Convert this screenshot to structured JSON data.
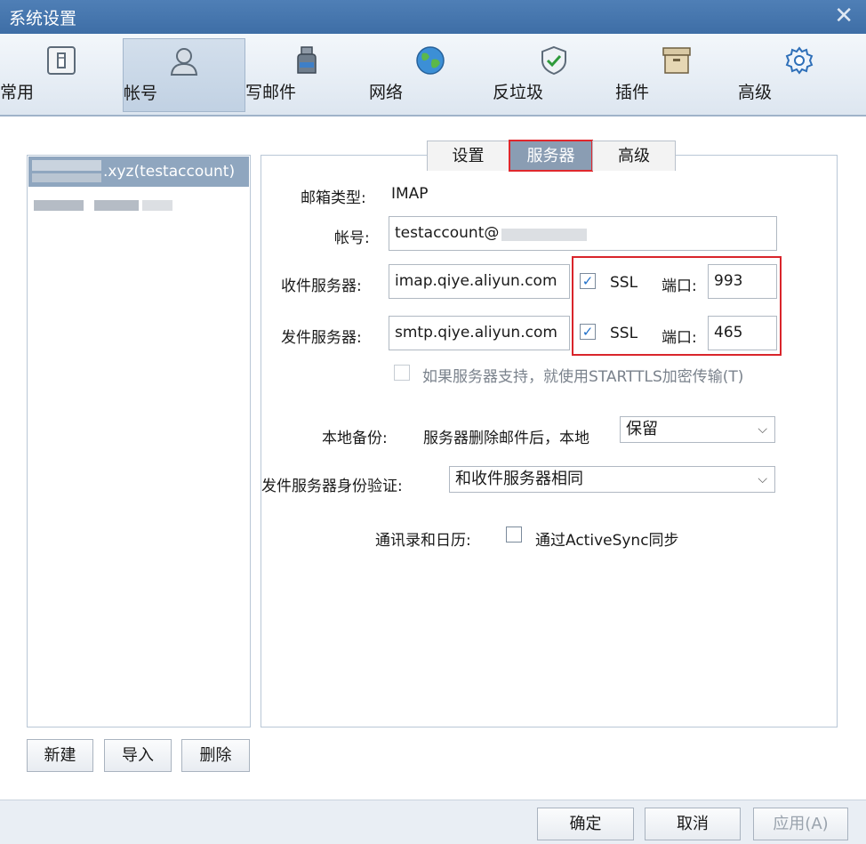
{
  "window": {
    "title": "系统设置",
    "close_glyph": "✕"
  },
  "toolbar": {
    "items": [
      {
        "label": "常用",
        "icon": "switch-icon"
      },
      {
        "label": "帐号",
        "icon": "user-icon",
        "active": true
      },
      {
        "label": "写邮件",
        "icon": "ink-bottle-icon"
      },
      {
        "label": "网络",
        "icon": "globe-icon"
      },
      {
        "label": "反垃圾",
        "icon": "shield-check-icon"
      },
      {
        "label": "插件",
        "icon": "box-icon"
      },
      {
        "label": "高级",
        "icon": "gear-icon"
      }
    ]
  },
  "accounts": {
    "items": [
      {
        "label": ".xyz(testaccount)",
        "selected": true
      }
    ],
    "buttons": {
      "new": "新建",
      "import": "导入",
      "delete": "删除"
    }
  },
  "tabs": [
    {
      "label": "设置"
    },
    {
      "label": "服务器",
      "active": true
    },
    {
      "label": "高级"
    }
  ],
  "server": {
    "mailbox_type_label": "邮箱类型:",
    "mailbox_type_value": "IMAP",
    "account_label": "帐号:",
    "account_value": "testaccount@",
    "incoming_label": "收件服务器:",
    "incoming_value": "imap.qiye.aliyun.com",
    "incoming_ssl_label": "SSL",
    "incoming_ssl_checked": true,
    "incoming_port_label": "端口:",
    "incoming_port_value": "993",
    "outgoing_label": "发件服务器:",
    "outgoing_value": "smtp.qiye.aliyun.com",
    "outgoing_ssl_label": "SSL",
    "outgoing_ssl_checked": true,
    "outgoing_port_label": "端口:",
    "outgoing_port_value": "465",
    "starttls_label": "如果服务器支持，就使用STARTTLS加密传输(T)",
    "backup_label": "本地备份:",
    "backup_desc": "服务器删除邮件后，本地",
    "backup_value": "保留",
    "auth_label": "发件服务器身份验证:",
    "auth_value": "和收件服务器相同",
    "sync_label": "通讯录和日历:",
    "sync_option": "通过ActiveSync同步",
    "checkmark": "✓",
    "dropdown_arrow": "⌵"
  },
  "footer": {
    "ok": "确定",
    "cancel": "取消",
    "apply": "应用(A)"
  },
  "colors": {
    "title_bar": "#4a7ab2",
    "highlight_box": "#d9252b",
    "selected_row": "#8fa6bf"
  }
}
